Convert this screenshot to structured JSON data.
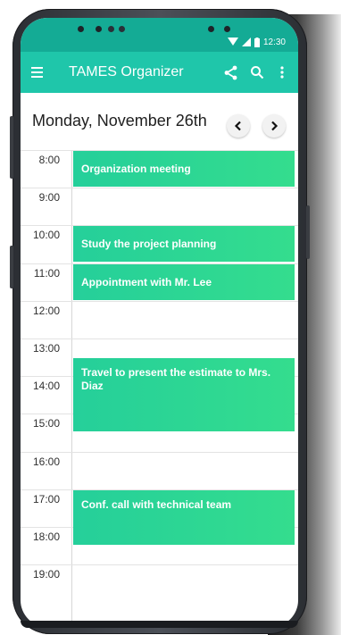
{
  "status_bar": {
    "time": "12:30"
  },
  "app_bar": {
    "title": "TAMES Organizer"
  },
  "header": {
    "date": "Monday, November 26th",
    "prev_glyph": "‹",
    "next_glyph": "›"
  },
  "time_labels": [
    "8:00",
    "9:00",
    "10:00",
    "11:00",
    "12:00",
    "13:00",
    "14:00",
    "15:00",
    "16:00",
    "17:00",
    "18:00",
    "19:00"
  ],
  "events": [
    {
      "title": "Organization meeting",
      "start": "8:00",
      "end": "9:00"
    },
    {
      "title": "Study the project planning",
      "start": "10:00",
      "end": "11:00"
    },
    {
      "title": "Appointment with Mr. Lee",
      "start": "11:00",
      "end": "12:00"
    },
    {
      "title": "Travel to present the estimate to Mrs. Diaz",
      "start": "13:30",
      "end": "15:30"
    },
    {
      "title": "Conf. call with technical team",
      "start": "17:00",
      "end": "18:30"
    }
  ],
  "colors": {
    "status_bar": "#14ab95",
    "app_bar": "#1fc6aa",
    "event_gradient_start": "#25cf9a",
    "event_gradient_end": "#34dd8e"
  }
}
